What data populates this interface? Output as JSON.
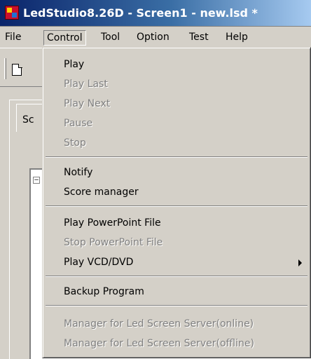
{
  "window": {
    "title": "LedStudio8.26D - Screen1 - new.lsd *"
  },
  "menubar": {
    "file": "File",
    "control": "Control",
    "tool": "Tool",
    "option": "Option",
    "test": "Test",
    "help": "Help"
  },
  "panel": {
    "tab_label": "Sc"
  },
  "control_menu": {
    "items": [
      {
        "label": "Play",
        "enabled": true
      },
      {
        "label": "Play Last",
        "enabled": false
      },
      {
        "label": "Play Next",
        "enabled": false
      },
      {
        "label": "Pause",
        "enabled": false
      },
      {
        "label": "Stop",
        "enabled": false
      },
      {
        "label": "Notify",
        "enabled": true
      },
      {
        "label": "Score manager",
        "enabled": true
      },
      {
        "label": "Play PowerPoint File",
        "enabled": true
      },
      {
        "label": "Stop PowerPoint File",
        "enabled": false
      },
      {
        "label": "Play VCD/DVD",
        "enabled": true,
        "submenu": true
      },
      {
        "label": "Backup Program",
        "enabled": true
      },
      {
        "label": "Manager for Led Screen Server(online)",
        "enabled": false
      },
      {
        "label": "Manager for Led Screen Server(offline)",
        "enabled": false
      }
    ]
  },
  "icons": [
    "app-icon",
    "new-document-icon",
    "submenu-arrow-icon",
    "tree-expand-icon"
  ]
}
